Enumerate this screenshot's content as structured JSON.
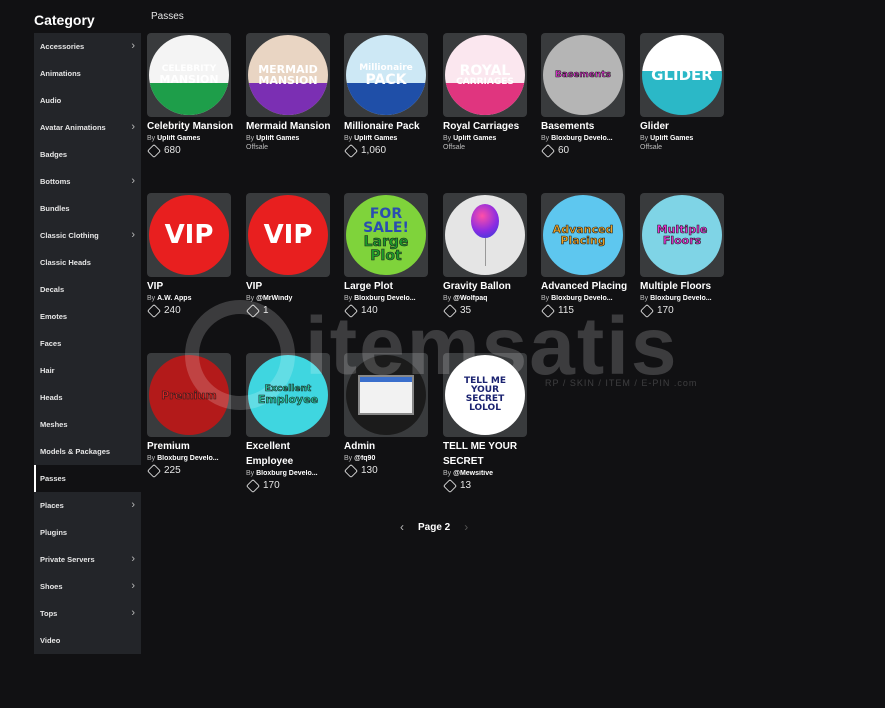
{
  "sidebar": {
    "title": "Category",
    "items": [
      {
        "label": "Accessories",
        "chevron": true
      },
      {
        "label": "Animations",
        "chevron": false
      },
      {
        "label": "Audio",
        "chevron": false
      },
      {
        "label": "Avatar Animations",
        "chevron": true
      },
      {
        "label": "Badges",
        "chevron": false
      },
      {
        "label": "Bottoms",
        "chevron": true
      },
      {
        "label": "Bundles",
        "chevron": false
      },
      {
        "label": "Classic Clothing",
        "chevron": true
      },
      {
        "label": "Classic Heads",
        "chevron": false
      },
      {
        "label": "Decals",
        "chevron": false
      },
      {
        "label": "Emotes",
        "chevron": false
      },
      {
        "label": "Faces",
        "chevron": false
      },
      {
        "label": "Hair",
        "chevron": false
      },
      {
        "label": "Heads",
        "chevron": false
      },
      {
        "label": "Meshes",
        "chevron": false
      },
      {
        "label": "Models & Packages",
        "chevron": false
      },
      {
        "label": "Passes",
        "chevron": false,
        "active": true
      },
      {
        "label": "Places",
        "chevron": true
      },
      {
        "label": "Plugins",
        "chevron": false
      },
      {
        "label": "Private Servers",
        "chevron": true
      },
      {
        "label": "Shoes",
        "chevron": true
      },
      {
        "label": "Tops",
        "chevron": true
      },
      {
        "label": "Video",
        "chevron": false
      }
    ]
  },
  "main": {
    "section_title": "Passes",
    "by_label": "By",
    "items": [
      {
        "name": "Celebrity Mansion",
        "creator": "Uplift Games",
        "price": "680",
        "thumb_text": [
          "CELEBRITY",
          "MANSION"
        ],
        "colors": [
          "#f4f4f4",
          "#1e9e4a",
          "#ffffff"
        ]
      },
      {
        "name": "Mermaid Mansion",
        "creator": "Uplift Games",
        "status": "Offsale",
        "thumb_text": [
          "MERMAID",
          "MANSION"
        ],
        "colors": [
          "#e9d5c3",
          "#7b2fb3",
          "#ffffff"
        ]
      },
      {
        "name": "Millionaire Pack",
        "creator": "Uplift Games",
        "price": "1,060",
        "thumb_text": [
          "Millionaire",
          "PACK"
        ],
        "colors": [
          "#cde8f5",
          "#1f4fa8",
          "#ffffff"
        ]
      },
      {
        "name": "Royal Carriages",
        "creator": "Uplift Games",
        "status": "Offsale",
        "thumb_text": [
          "ROYAL",
          "CARRIAGES"
        ],
        "colors": [
          "#fbe7ef",
          "#e0357f",
          "#ffffff"
        ]
      },
      {
        "name": "Basements",
        "creator": "Bloxburg Develo...",
        "price": "60",
        "thumb_text": [
          "Basements"
        ],
        "colors": [
          "#b5b5b5",
          "#e733d8",
          "#ffffff"
        ]
      },
      {
        "name": "Glider",
        "creator": "Uplift Games",
        "status": "Offsale",
        "thumb_text": [
          "GLIDER"
        ],
        "colors": [
          "#ffffff",
          "#2bb8c7",
          "#ffffff"
        ]
      },
      {
        "name": "VIP",
        "creator": "A.W. Apps",
        "price": "240",
        "thumb_text": [
          "VIP"
        ],
        "colors": [
          "#e81f1f",
          "#ffffff",
          "#ffffff"
        ]
      },
      {
        "name": "VIP",
        "creator": "@MrWindy",
        "price": "1",
        "thumb_text": [
          "VIP"
        ],
        "colors": [
          "#e81f1f",
          "#ffffff",
          "#ffffff"
        ]
      },
      {
        "name": "Large Plot",
        "creator": "Bloxburg Develo...",
        "price": "140",
        "thumb_text": [
          "FOR",
          "SALE!",
          "Large",
          "Plot"
        ],
        "colors": [
          "#7fd33b",
          "#1c9b2a",
          "#ffffff"
        ]
      },
      {
        "name": "Gravity Ballon",
        "creator": "@Wolfpaq",
        "price": "35",
        "thumb_text": [],
        "colors": [
          "#e5e5e5",
          "#8a2be2",
          "#ffffff"
        ]
      },
      {
        "name": "Advanced Placing",
        "creator": "Bloxburg Develo...",
        "price": "115",
        "thumb_text": [
          "Advanced",
          "Placing"
        ],
        "colors": [
          "#5ec7ef",
          "#f2a623",
          "#ffffff"
        ]
      },
      {
        "name": "Multiple Floors",
        "creator": "Bloxburg Develo...",
        "price": "170",
        "thumb_text": [
          "Multiple",
          "Floors"
        ],
        "colors": [
          "#7fd4e6",
          "#e733d8",
          "#ffffff"
        ]
      },
      {
        "name": "Premium",
        "creator": "Bloxburg Develo...",
        "price": "225",
        "thumb_text": [
          "Premium"
        ],
        "colors": [
          "#b31a1a",
          "#e02020",
          "#ffffff"
        ]
      },
      {
        "name": "Excellent Employee",
        "creator": "Bloxburg Develo...",
        "price": "170",
        "thumb_text": [
          "Excellent",
          "Employee"
        ],
        "colors": [
          "#3fd6e0",
          "#1ec9a0",
          "#ffffff"
        ]
      },
      {
        "name": "Admin",
        "creator": "@fq90",
        "price": "130",
        "thumb_text": [],
        "colors": [
          "#1b1b1b",
          "#cfcfcf",
          "#ffffff"
        ]
      },
      {
        "name": "TELL ME YOUR SECRET",
        "creator": "@Mewsitive",
        "price": "13",
        "thumb_text": [
          "TELL ME",
          "YOUR",
          "SECRET",
          "LOLOL"
        ],
        "colors": [
          "#ffffff",
          "#1a2270",
          "#1a2270"
        ]
      }
    ]
  },
  "pagination": {
    "label": "Page 2",
    "prev_icon": "chevron-left-icon",
    "next_icon": "chevron-right-icon"
  },
  "watermark": {
    "text": "itemsatis",
    "subtext": "RP / SKIN / ITEM / E-PIN .com"
  }
}
